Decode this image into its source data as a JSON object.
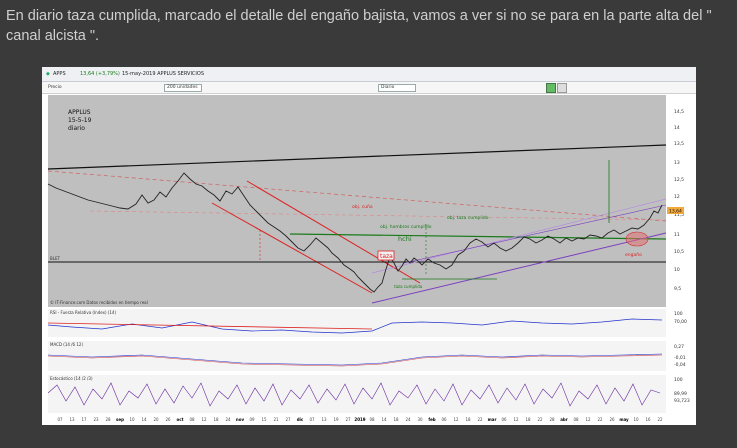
{
  "post": {
    "caption": "En diario taza cumplida, marcado el detalle del engaño bajista, vamos a ver si no se para en la parte alta del \" canal alcista \"."
  },
  "chart": {
    "header": {
      "symbol": "APPS",
      "price_change": "13,64 (+3,79%)",
      "date_name": "15-may-2019 APPLUS SERVICIOS"
    },
    "toolbar": {
      "price_label": "Precio",
      "units": "200 unidades",
      "period": "Diario"
    },
    "note": {
      "line1": "APPLUS",
      "line2": "15-5-19",
      "line3": "diario"
    },
    "annotations": {
      "obj_cuna": "obj. cuña",
      "obj_hombros": "obj. hombros cumplido",
      "obj_taza": "obj. taza cumplido",
      "hchi": "hchi",
      "taza": "taza",
      "taza_cumplida": "taza cumplida",
      "engano": "engaño",
      "level_label": "BLET"
    },
    "price_axis": [
      "14,5",
      "14",
      "13,5",
      "13",
      "12,5",
      "12",
      "11,5",
      "11",
      "10,5",
      "10",
      "9,5",
      "9"
    ],
    "last_price": "13,64",
    "source": "© IT-Finance.com Datos recibidos en tiempo real",
    "indicators": {
      "rsi": "RSI - Fuerza Relativa (Index) (14)",
      "rsi_axis": [
        "100",
        "70,00"
      ],
      "macd": "MACD (14 /6 12)",
      "macd_axis": [
        "0,27",
        "-0,01",
        "-0,04"
      ],
      "stoch": "Estocástico (14 /2 /3)",
      "stoch_axis": [
        "100",
        "89,99",
        "93,723"
      ]
    },
    "dates": [
      "07",
      "13",
      "17",
      "23",
      "28",
      "sep",
      "10",
      "14",
      "20",
      "26",
      "oct",
      "08",
      "12",
      "18",
      "24",
      "nov",
      "09",
      "15",
      "21",
      "27",
      "dic",
      "07",
      "13",
      "19",
      "27",
      "2019",
      "08",
      "14",
      "18",
      "24",
      "30",
      "feb",
      "06",
      "12",
      "18",
      "22",
      "mar",
      "06",
      "12",
      "18",
      "22",
      "28",
      "abr",
      "08",
      "12",
      "22",
      "26",
      "may",
      "10",
      "16",
      "22"
    ]
  }
}
